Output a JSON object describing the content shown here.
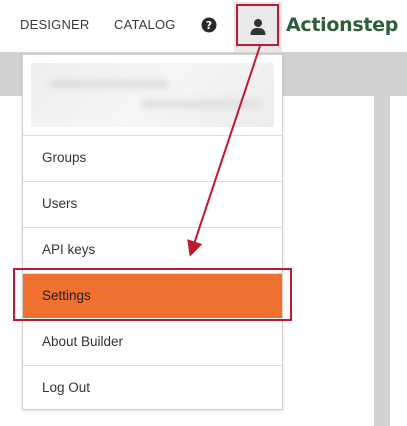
{
  "nav": {
    "designer": "DESIGNER",
    "catalog": "CATALOG",
    "help_icon": "question-circle-icon",
    "user_icon": "user-icon"
  },
  "logo": {
    "text": "Actionstep",
    "color": "#2c5f3a"
  },
  "dropdown": {
    "profile": "blurred user profile",
    "items": [
      {
        "label": "Groups"
      },
      {
        "label": "Users"
      },
      {
        "label": "API keys"
      },
      {
        "label": "Settings",
        "active": true
      },
      {
        "label": "About Builder"
      },
      {
        "label": "Log Out"
      }
    ]
  },
  "colors": {
    "active_item": "#f07030",
    "annotation": "#c01a2e",
    "backdrop": "#d2d2d2"
  }
}
